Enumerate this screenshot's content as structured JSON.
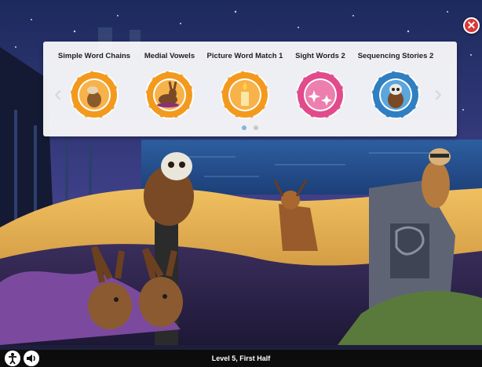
{
  "colors": {
    "panel": "#ffffff",
    "orange": "#f39a1e",
    "pink": "#e24b8b",
    "blue": "#2f7fc2",
    "close": "#d63a3a",
    "bar": "#0c0c0c"
  },
  "menu": {
    "left_arrow": "‹",
    "right_arrow": "›",
    "activities": [
      {
        "title": "Simple Word Chains",
        "icon": "otter-icon",
        "color": "#f39a1e"
      },
      {
        "title": "Medial Vowels",
        "icon": "hare-icon",
        "color": "#f39a1e"
      },
      {
        "title": "Picture Word Match 1",
        "icon": "candle-icon",
        "color": "#f39a1e"
      },
      {
        "title": "Sight Words 2",
        "icon": "stars-icon",
        "color": "#e24b8b"
      },
      {
        "title": "Sequencing Stories 2",
        "icon": "owl-icon",
        "color": "#2f7fc2"
      }
    ],
    "pages": 2,
    "current_page": 1
  },
  "close_label": "✕",
  "bottom_bar": {
    "level_text": "Level 5, First Half",
    "accessibility_icon": "accessibility-icon",
    "sound_icon": "speaker-icon"
  }
}
